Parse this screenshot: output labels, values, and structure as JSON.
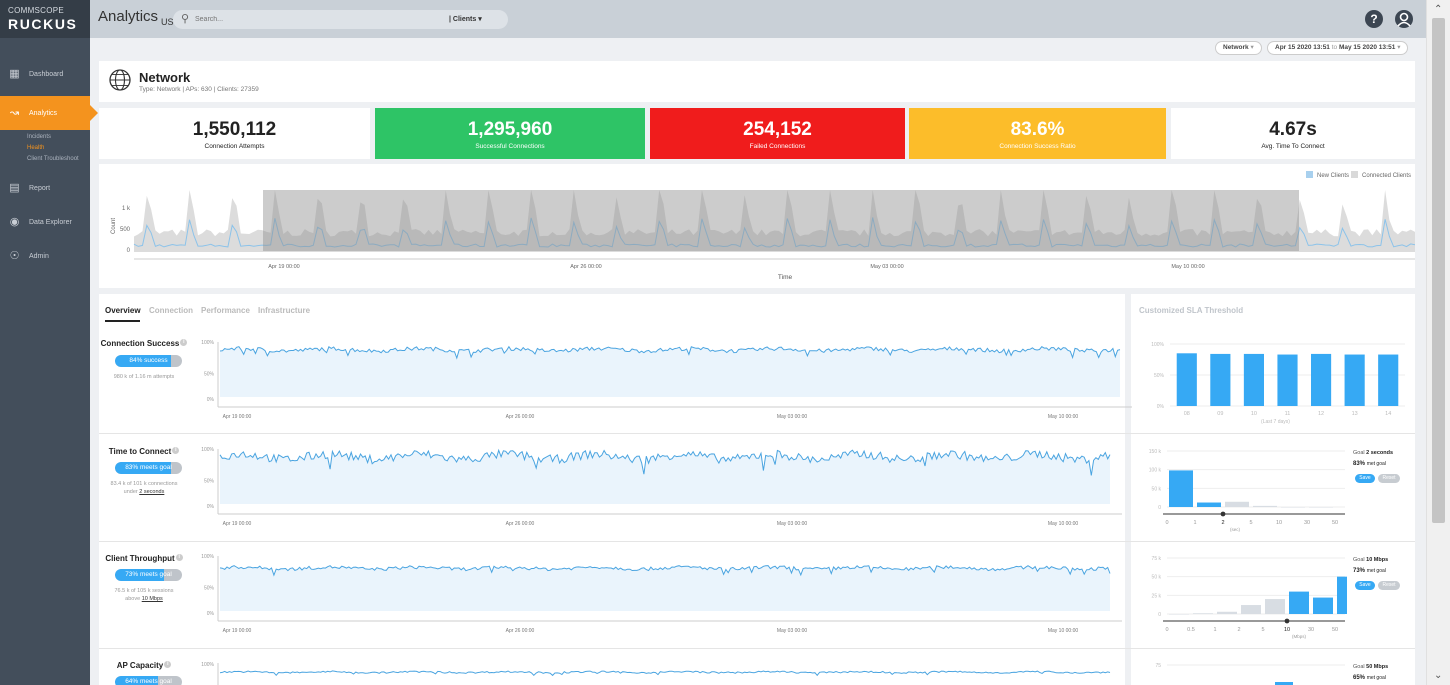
{
  "brand": {
    "line1": "COMMSCOPE",
    "line2": "RUCKUS"
  },
  "sidebar": {
    "items": [
      {
        "label": "Dashboard",
        "icon": "dashboard-icon"
      },
      {
        "label": "Analytics",
        "icon": "analytics-icon",
        "active": true
      },
      {
        "label": "Report",
        "icon": "report-icon"
      },
      {
        "label": "Data Explorer",
        "icon": "data-explorer-icon"
      },
      {
        "label": "Admin",
        "icon": "admin-icon"
      }
    ],
    "subitems": [
      "Incidents",
      "Health",
      "Client Troubleshoot"
    ],
    "active_subitem": "Health"
  },
  "header": {
    "title": "Analytics",
    "region": "US",
    "search_placeholder": "Search...",
    "search_scope": "Clients",
    "help_label": "?",
    "accent": "#f4931e"
  },
  "filters": {
    "scope": "Network",
    "date_from": "Apr 15 2020 13:51",
    "date_to_word": "to",
    "date_to": "May 15 2020 13:51"
  },
  "network": {
    "name": "Network",
    "meta": "Type: Network  |  APs: 630  |  Clients: 27359"
  },
  "kpis": [
    {
      "value": "1,550,112",
      "label": "Connection Attempts",
      "color": "#ffffff"
    },
    {
      "value": "1,295,960",
      "label": "Successful Connections",
      "color": "#2ec466"
    },
    {
      "value": "254,152",
      "label": "Failed Connections",
      "color": "#f01c1c"
    },
    {
      "value": "83.6%",
      "label": "Connection Success Ratio",
      "color": "#fcbd2a"
    },
    {
      "value": "4.67s",
      "label": "Avg. Time To Connect",
      "color": "#ffffff"
    }
  ],
  "timeline": {
    "legend": [
      "New Clients",
      "Connected Clients"
    ],
    "ylabel": "Count",
    "yticks": [
      "1 k",
      "500",
      "0"
    ],
    "xticks": [
      "Apr 19 00:00",
      "Apr 26 00:00",
      "May 03 00:00",
      "May 10 00:00"
    ],
    "xlabel": "Time"
  },
  "tabs": [
    "Overview",
    "Connection",
    "Performance",
    "Infrastructure"
  ],
  "sla_title": "Customized SLA Threshold",
  "metrics": [
    {
      "title": "Connection Success",
      "badge": "84% success",
      "badge_pct": 84,
      "sub1": "980 k of 1.16 m attempts",
      "sub2": "",
      "sub_link": "",
      "yticks": [
        "100%",
        "50%",
        "0%"
      ]
    },
    {
      "title": "Time to Connect",
      "badge": "83% meets goal",
      "badge_pct": 83,
      "sub1": "83.4 k of 101 k connections",
      "sub2": "under",
      "sub_link": "2 seconds",
      "yticks": [
        "100%",
        "50%",
        "0%"
      ]
    },
    {
      "title": "Client Throughput",
      "badge": "73% meets goal",
      "badge_pct": 73,
      "sub1": "76.5 k of 105 k sessions",
      "sub2": "above",
      "sub_link": "10 Mbps",
      "yticks": [
        "100%",
        "50%",
        "0%"
      ]
    },
    {
      "title": "AP Capacity",
      "badge": "64% meets goal",
      "badge_pct": 64,
      "sub1": "",
      "sub2": "",
      "sub_link": "",
      "yticks": [
        "100%"
      ]
    }
  ],
  "chart_xticks": [
    "Apr 19 00:00",
    "Apr 26 00:00",
    "May 03 00:00",
    "May 10 00:00"
  ],
  "sla_charts": [
    {
      "type": "bar",
      "categories": [
        "08",
        "09",
        "10",
        "11",
        "12",
        "13",
        "14"
      ],
      "values": [
        85,
        84,
        84,
        83,
        84,
        83,
        83
      ],
      "yticks": [
        "100%",
        "50%",
        "0%"
      ],
      "ylim": [
        0,
        100
      ],
      "xlabel": "(Last 7 days)"
    },
    {
      "type": "bar",
      "xticks": [
        "0",
        "1",
        "2",
        "5",
        "10",
        "30",
        "50"
      ],
      "values": [
        98,
        12,
        14,
        3,
        0,
        0
      ],
      "highlight": [
        true,
        true,
        false,
        false,
        false,
        false
      ],
      "yticks": [
        "150 k",
        "100 k",
        "50 k",
        "0"
      ],
      "ylim": [
        0,
        150
      ],
      "unit": "(sec)",
      "goal_label": "Goal",
      "goal_value": "2 seconds",
      "met_value": "83%",
      "met_label": "met goal",
      "save": "Save",
      "reset": "Reset"
    },
    {
      "type": "bar",
      "xticks": [
        "0",
        "0.5",
        "1",
        "2",
        "5",
        "10",
        "30",
        "50"
      ],
      "values": [
        0,
        1,
        3,
        12,
        20,
        30,
        22,
        50
      ],
      "highlight": [
        false,
        false,
        false,
        false,
        false,
        true,
        true,
        true
      ],
      "yticks": [
        "75 k",
        "50 k",
        "25 k",
        "0"
      ],
      "ylim": [
        0,
        75
      ],
      "unit": "(Mbps)",
      "goal_label": "Goal",
      "goal_value": "10 Mbps",
      "met_value": "73%",
      "met_label": "met goal",
      "save": "Save",
      "reset": "Reset"
    },
    {
      "type": "bar",
      "yticks": [
        "75"
      ],
      "goal_label": "Goal",
      "goal_value": "50 Mbps",
      "met_value": "65%",
      "met_label": "met goal"
    }
  ]
}
